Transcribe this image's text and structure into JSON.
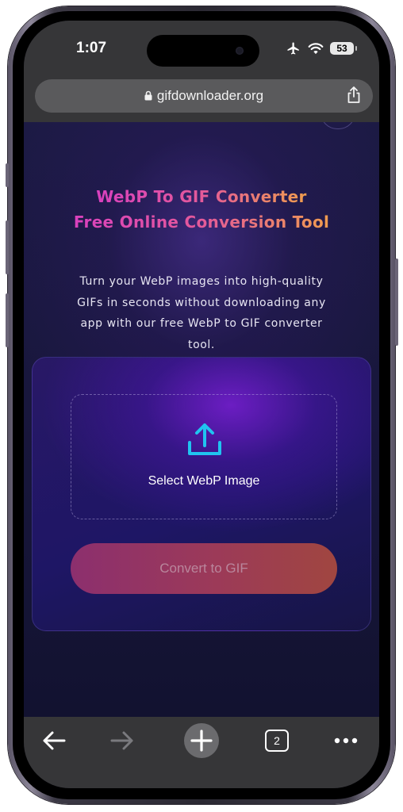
{
  "status_bar": {
    "time": "1:07",
    "battery": "53",
    "icons": [
      "airplane-icon",
      "wifi-icon",
      "battery-icon"
    ]
  },
  "browser": {
    "url": "gifdownloader.org",
    "share_icon": "share-icon",
    "lock_icon": "lock-icon"
  },
  "hero": {
    "title_line1": "WebP To GIF Converter",
    "title_line2": "Free Online Conversion Tool",
    "description": "Turn your WebP images into high-quality GIFs in seconds without downloading any app with our free WebP to GIF converter tool."
  },
  "converter": {
    "select_label": "Select WebP Image",
    "upload_icon": "upload-icon",
    "convert_label": "Convert to GIF"
  },
  "toolbar": {
    "tab_count": "2",
    "icons": [
      "back-arrow-icon",
      "forward-arrow-icon",
      "plus-icon",
      "tabs-icon",
      "more-icon"
    ]
  },
  "colors": {
    "title_gradient_start": "#d83fc0",
    "title_gradient_end": "#f0a04a",
    "upload_icon": "#20c4f0",
    "button_gradient_start": "#8c2f6e",
    "button_gradient_end": "#a04640",
    "browser_chrome": "#363638"
  }
}
